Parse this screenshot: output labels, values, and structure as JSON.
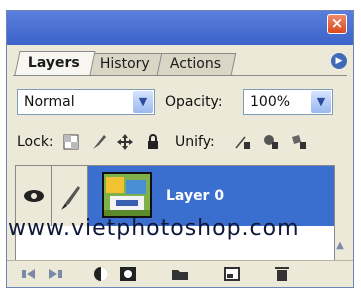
{
  "tabs": [
    {
      "label": "Layers"
    },
    {
      "label": "History"
    },
    {
      "label": "Actions"
    }
  ],
  "blend_mode": {
    "value": "Normal"
  },
  "opacity": {
    "label": "Opacity:",
    "value": "100%"
  },
  "lock": {
    "label": "Lock:"
  },
  "unify": {
    "label": "Unify:"
  },
  "layers": [
    {
      "name": "Layer 0",
      "visible": true,
      "selected": true
    }
  ],
  "watermark": "www.vietphotoshop.com",
  "colors": {
    "titlebar": "#3d63c9",
    "selection": "#3a6fd0",
    "panel": "#ece9d8",
    "close": "#d8481e"
  },
  "icons": {
    "close": "close-icon",
    "panel_menu": "panel-menu-icon",
    "eye": "eye-icon",
    "brush": "brush-icon"
  }
}
